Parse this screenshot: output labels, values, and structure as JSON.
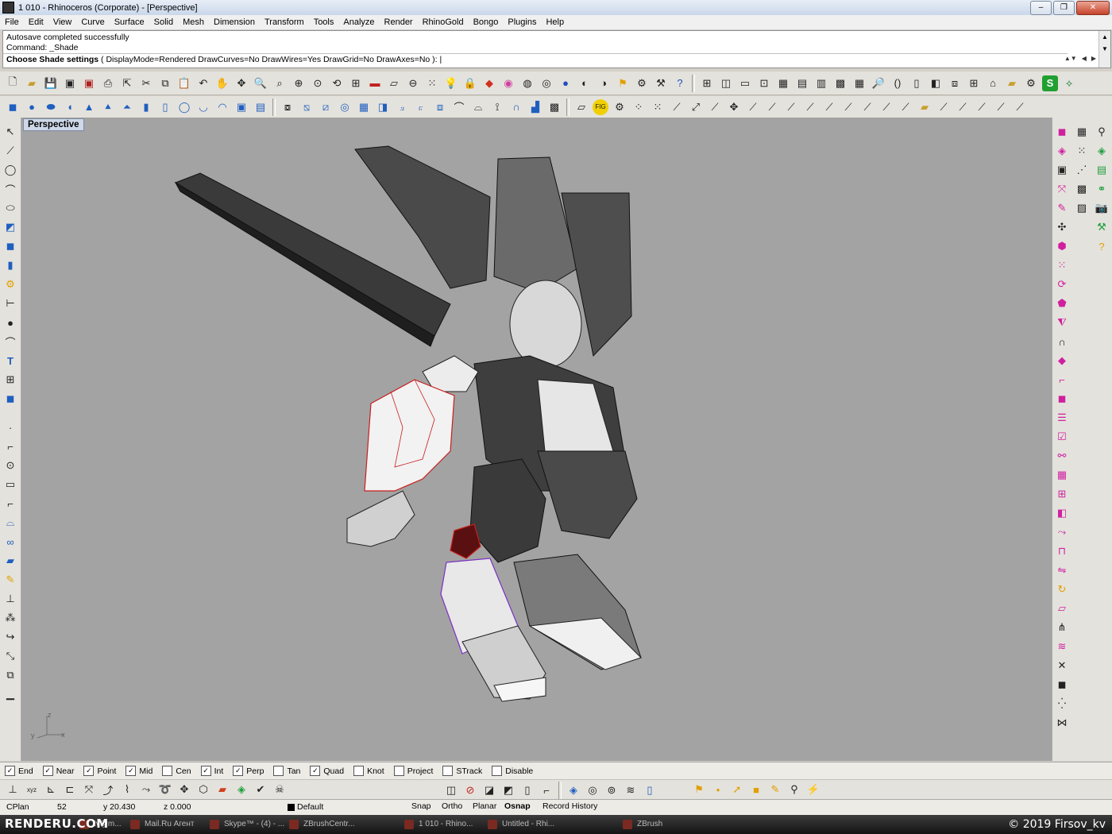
{
  "window": {
    "title": "1 010 - Rhinoceros (Corporate) - [Perspective]",
    "minimize": "–",
    "maximize": "❐",
    "close": "✕"
  },
  "menu": [
    "File",
    "Edit",
    "View",
    "Curve",
    "Surface",
    "Solid",
    "Mesh",
    "Dimension",
    "Transform",
    "Tools",
    "Analyze",
    "Render",
    "RhinoGold",
    "Bongo",
    "Plugins",
    "Help"
  ],
  "command": {
    "history_1": "Autosave completed successfully",
    "history_2": "Command: _Shade",
    "prompt_label": "Choose Shade settings",
    "prompt_options": "( DisplayMode=Rendered  DrawCurves=No  DrawWires=Yes  DrawGrid=No  DrawAxes=No ):"
  },
  "viewport": {
    "tab_label": "Perspective",
    "axis_z": "z",
    "axis_y": "y",
    "axis_x": "x"
  },
  "osnap": [
    {
      "label": "End",
      "checked": true
    },
    {
      "label": "Near",
      "checked": true
    },
    {
      "label": "Point",
      "checked": true
    },
    {
      "label": "Mid",
      "checked": true
    },
    {
      "label": "Cen",
      "checked": false
    },
    {
      "label": "Int",
      "checked": true
    },
    {
      "label": "Perp",
      "checked": true
    },
    {
      "label": "Tan",
      "checked": false
    },
    {
      "label": "Quad",
      "checked": true
    },
    {
      "label": "Knot",
      "checked": false
    },
    {
      "label": "Project",
      "checked": false
    },
    {
      "label": "STrack",
      "checked": false
    },
    {
      "label": "Disable",
      "checked": false
    }
  ],
  "status": {
    "cplane": "CPlan",
    "x_fragment": "52",
    "y": "y 20.430",
    "z": "z 0.000",
    "layer": "Default",
    "snap": "Snap",
    "ortho": "Ortho",
    "planar": "Planar",
    "osnap": "Osnap",
    "record_history": "Record History"
  },
  "taskbar": [
    "tv@m...",
    "Mail.Ru Агент",
    "Skype™ - (4) - ...",
    "ZBrushCentr...",
    "1 010 - Rhino...",
    "Untitled - Rhi...",
    "ZBrush"
  ],
  "watermark": {
    "left": "RENDERU.COM",
    "right": "© 2019 Firsov_kv"
  },
  "colors": {
    "viewport_bg": "#a3a3a3",
    "selected_red": "#c81e1e",
    "selected_purple": "#7a30c0"
  }
}
